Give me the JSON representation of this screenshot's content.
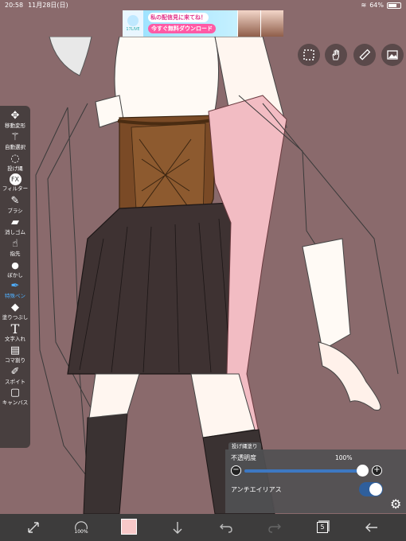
{
  "status_bar": {
    "time": "20:58",
    "date": "11月28日(日)",
    "battery": "64%"
  },
  "ad": {
    "brand": "17LIVE",
    "headline": "私の配信見に来てね！",
    "cta": "今すぐ無料ダウンロード",
    "colors": {
      "bg": "#9fe3ff",
      "accent": "#ff5aa5"
    }
  },
  "top_tools": [
    {
      "name": "selection-icon"
    },
    {
      "name": "hand-icon"
    },
    {
      "name": "ruler-icon"
    },
    {
      "name": "image-icon"
    }
  ],
  "left_toolbar": {
    "tools": [
      {
        "label": "移動変形",
        "icon": "move-icon",
        "glyph": "✥"
      },
      {
        "label": "自動選択",
        "icon": "magic-wand-icon",
        "glyph": "⚚"
      },
      {
        "label": "投げ縄",
        "icon": "lasso-icon",
        "glyph": "◌"
      },
      {
        "label": "フィルター",
        "icon": "filter-fx-icon",
        "glyph": "FX"
      },
      {
        "label": "ブラシ",
        "icon": "brush-icon",
        "glyph": "✎"
      },
      {
        "label": "消しゴム",
        "icon": "eraser-icon",
        "glyph": "▰"
      },
      {
        "label": "指先",
        "icon": "finger-icon",
        "glyph": "☝"
      },
      {
        "label": "ぼかし",
        "icon": "blur-drop-icon",
        "glyph": "💧"
      },
      {
        "label": "特殊ペン",
        "icon": "special-pen-icon",
        "glyph": "✒",
        "active": true
      },
      {
        "label": "塗りつぶし",
        "icon": "fill-bucket-icon",
        "glyph": "◆"
      },
      {
        "label": "文字入れ",
        "icon": "text-icon",
        "glyph": "T"
      },
      {
        "label": "コマ割り",
        "icon": "frame-divider-icon",
        "glyph": "▤"
      },
      {
        "label": "スポイト",
        "icon": "eyedropper-icon",
        "glyph": "✐"
      },
      {
        "label": "キャンバス",
        "icon": "canvas-icon",
        "glyph": "▢"
      }
    ]
  },
  "brush_panel": {
    "tab_label": "投げ縄塗り",
    "opacity_label": "不透明度",
    "opacity_value": "100%",
    "opacity": 1.0,
    "minus": "−",
    "plus": "+",
    "antialias_label": "アンチエイリアス",
    "antialias_on": true
  },
  "bottom_bar": {
    "brush_size_label": "100%",
    "color": "#f7c8c8",
    "layer_count": "5"
  },
  "canvas": {
    "background": "#8a6a6c"
  }
}
